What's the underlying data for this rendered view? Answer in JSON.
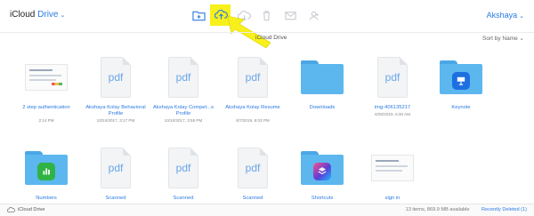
{
  "header": {
    "brand_prefix": "iCloud",
    "brand_suffix": "Drive",
    "user": "Akshaya",
    "toolbar_icons": [
      "new-folder-icon",
      "upload-icon",
      "download-icon",
      "trash-icon",
      "email-icon",
      "share-icon"
    ],
    "highlight_color": "#f7f01a",
    "accent_color": "#2a7ae2"
  },
  "subheader": {
    "title": "iCloud Drive",
    "sort_label": "Sort by Name"
  },
  "items": [
    {
      "name": "2 step authentication",
      "meta": "2:14 PM",
      "kind": "screenshot"
    },
    {
      "name": "Akshaya Kolay Behavioral Profile",
      "meta": "10/24/2017, 3:17 PM",
      "kind": "pdf"
    },
    {
      "name": "Akshaya Kolay Compet...s Profile",
      "meta": "10/10/2017, 3:55 PM",
      "kind": "pdf"
    },
    {
      "name": "Akshaya Kolay Resume",
      "meta": "6/7/2019, 8:03 PM",
      "kind": "pdf"
    },
    {
      "name": "Downloads",
      "meta": "",
      "kind": "folder"
    },
    {
      "name": "img-406135217",
      "meta": "6/30/2019, 6:30 AM",
      "kind": "pdf"
    },
    {
      "name": "Keynote",
      "meta": "",
      "kind": "keynote"
    },
    {
      "name": "Numbers",
      "meta": "",
      "kind": "numbers"
    },
    {
      "name": "Scanned",
      "meta": "",
      "kind": "pdf"
    },
    {
      "name": "Scanned",
      "meta": "",
      "kind": "pdf"
    },
    {
      "name": "Scanned",
      "meta": "",
      "kind": "pdf"
    },
    {
      "name": "Shortcuts",
      "meta": "",
      "kind": "shortcuts"
    },
    {
      "name": "sign in",
      "meta": "",
      "kind": "screenshot"
    }
  ],
  "pdf_label": "pdf",
  "footer": {
    "drive_label": "iCloud Drive",
    "status": "13 items, 869.9 MB available",
    "recently_deleted": "Recently Deleted (1)"
  }
}
